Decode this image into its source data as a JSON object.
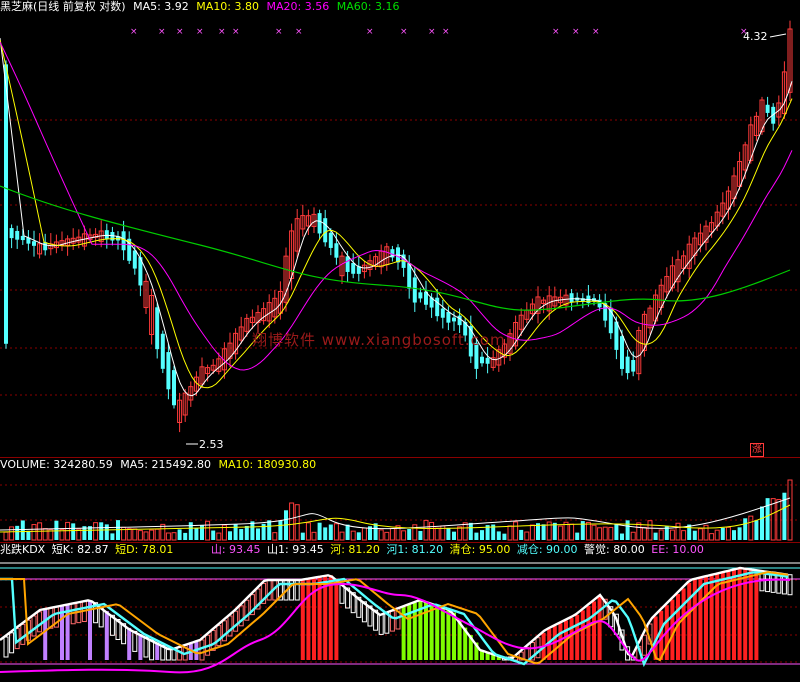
{
  "main_header": {
    "title": "黑芝麻(日线 前复权 对数)",
    "ma5": "MA5: 3.92",
    "ma10": "MA10: 3.80",
    "ma20": "MA20: 3.56",
    "ma60": "MA60: 3.16"
  },
  "price_marks": {
    "high": "4.32",
    "low": "2.53",
    "rise_badge": "涨"
  },
  "watermark": "翔博软件 www.xiangbosoft.com",
  "volume_header": {
    "volume": "VOLUME: 324280.59",
    "ma5": "MA5: 215492.80",
    "ma10": "MA10: 180930.80"
  },
  "kdx_header": {
    "name": "兆跌KDX",
    "short_k": "短K: 82.87",
    "short_d": "短D: 78.01",
    "shan": "山: 93.45",
    "shan1": "山1: 93.45",
    "he": "河: 81.20",
    "he1": "河1: 81.20",
    "qingcang": "清仓: 95.00",
    "jiancang": "减仓: 90.00",
    "jingjue": "警觉: 80.00",
    "ee": "EE: 10.00"
  },
  "colors": {
    "up": "#ff3b3b",
    "down": "#54ffff",
    "ma5": "#ffffff",
    "ma10": "#ffff00",
    "ma20": "#ff00ff",
    "ma60": "#00cc00",
    "magenta_text": "#ff55ff",
    "grid": "#8a0000"
  },
  "chart_data": {
    "type": "candlestick",
    "title": "黑芝麻(日线 前复权 对数)",
    "price_high": 4.32,
    "price_low": 2.53,
    "indicators": [
      "MA5",
      "MA10",
      "MA20",
      "MA60",
      "VOLUME",
      "KDX"
    ]
  }
}
